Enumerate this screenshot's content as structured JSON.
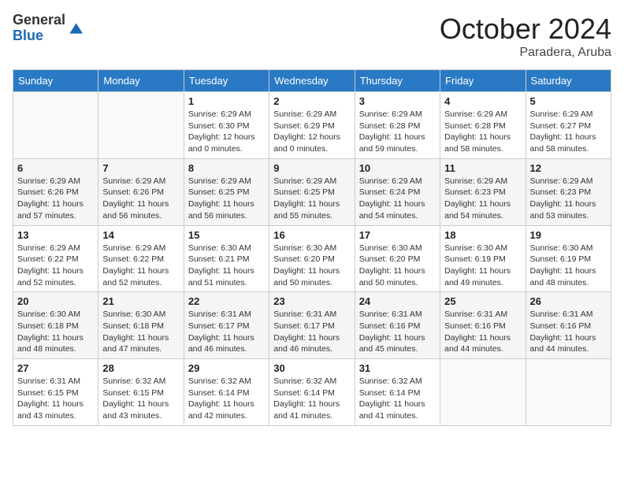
{
  "header": {
    "logo_general": "General",
    "logo_blue": "Blue",
    "month_title": "October 2024",
    "location": "Paradera, Aruba"
  },
  "weekdays": [
    "Sunday",
    "Monday",
    "Tuesday",
    "Wednesday",
    "Thursday",
    "Friday",
    "Saturday"
  ],
  "weeks": [
    [
      {
        "day": "",
        "info": ""
      },
      {
        "day": "",
        "info": ""
      },
      {
        "day": "1",
        "info": "Sunrise: 6:29 AM\nSunset: 6:30 PM\nDaylight: 12 hours and 0 minutes."
      },
      {
        "day": "2",
        "info": "Sunrise: 6:29 AM\nSunset: 6:29 PM\nDaylight: 12 hours and 0 minutes."
      },
      {
        "day": "3",
        "info": "Sunrise: 6:29 AM\nSunset: 6:28 PM\nDaylight: 11 hours and 59 minutes."
      },
      {
        "day": "4",
        "info": "Sunrise: 6:29 AM\nSunset: 6:28 PM\nDaylight: 11 hours and 58 minutes."
      },
      {
        "day": "5",
        "info": "Sunrise: 6:29 AM\nSunset: 6:27 PM\nDaylight: 11 hours and 58 minutes."
      }
    ],
    [
      {
        "day": "6",
        "info": "Sunrise: 6:29 AM\nSunset: 6:26 PM\nDaylight: 11 hours and 57 minutes."
      },
      {
        "day": "7",
        "info": "Sunrise: 6:29 AM\nSunset: 6:26 PM\nDaylight: 11 hours and 56 minutes."
      },
      {
        "day": "8",
        "info": "Sunrise: 6:29 AM\nSunset: 6:25 PM\nDaylight: 11 hours and 56 minutes."
      },
      {
        "day": "9",
        "info": "Sunrise: 6:29 AM\nSunset: 6:25 PM\nDaylight: 11 hours and 55 minutes."
      },
      {
        "day": "10",
        "info": "Sunrise: 6:29 AM\nSunset: 6:24 PM\nDaylight: 11 hours and 54 minutes."
      },
      {
        "day": "11",
        "info": "Sunrise: 6:29 AM\nSunset: 6:23 PM\nDaylight: 11 hours and 54 minutes."
      },
      {
        "day": "12",
        "info": "Sunrise: 6:29 AM\nSunset: 6:23 PM\nDaylight: 11 hours and 53 minutes."
      }
    ],
    [
      {
        "day": "13",
        "info": "Sunrise: 6:29 AM\nSunset: 6:22 PM\nDaylight: 11 hours and 52 minutes."
      },
      {
        "day": "14",
        "info": "Sunrise: 6:29 AM\nSunset: 6:22 PM\nDaylight: 11 hours and 52 minutes."
      },
      {
        "day": "15",
        "info": "Sunrise: 6:30 AM\nSunset: 6:21 PM\nDaylight: 11 hours and 51 minutes."
      },
      {
        "day": "16",
        "info": "Sunrise: 6:30 AM\nSunset: 6:20 PM\nDaylight: 11 hours and 50 minutes."
      },
      {
        "day": "17",
        "info": "Sunrise: 6:30 AM\nSunset: 6:20 PM\nDaylight: 11 hours and 50 minutes."
      },
      {
        "day": "18",
        "info": "Sunrise: 6:30 AM\nSunset: 6:19 PM\nDaylight: 11 hours and 49 minutes."
      },
      {
        "day": "19",
        "info": "Sunrise: 6:30 AM\nSunset: 6:19 PM\nDaylight: 11 hours and 48 minutes."
      }
    ],
    [
      {
        "day": "20",
        "info": "Sunrise: 6:30 AM\nSunset: 6:18 PM\nDaylight: 11 hours and 48 minutes."
      },
      {
        "day": "21",
        "info": "Sunrise: 6:30 AM\nSunset: 6:18 PM\nDaylight: 11 hours and 47 minutes."
      },
      {
        "day": "22",
        "info": "Sunrise: 6:31 AM\nSunset: 6:17 PM\nDaylight: 11 hours and 46 minutes."
      },
      {
        "day": "23",
        "info": "Sunrise: 6:31 AM\nSunset: 6:17 PM\nDaylight: 11 hours and 46 minutes."
      },
      {
        "day": "24",
        "info": "Sunrise: 6:31 AM\nSunset: 6:16 PM\nDaylight: 11 hours and 45 minutes."
      },
      {
        "day": "25",
        "info": "Sunrise: 6:31 AM\nSunset: 6:16 PM\nDaylight: 11 hours and 44 minutes."
      },
      {
        "day": "26",
        "info": "Sunrise: 6:31 AM\nSunset: 6:16 PM\nDaylight: 11 hours and 44 minutes."
      }
    ],
    [
      {
        "day": "27",
        "info": "Sunrise: 6:31 AM\nSunset: 6:15 PM\nDaylight: 11 hours and 43 minutes."
      },
      {
        "day": "28",
        "info": "Sunrise: 6:32 AM\nSunset: 6:15 PM\nDaylight: 11 hours and 43 minutes."
      },
      {
        "day": "29",
        "info": "Sunrise: 6:32 AM\nSunset: 6:14 PM\nDaylight: 11 hours and 42 minutes."
      },
      {
        "day": "30",
        "info": "Sunrise: 6:32 AM\nSunset: 6:14 PM\nDaylight: 11 hours and 41 minutes."
      },
      {
        "day": "31",
        "info": "Sunrise: 6:32 AM\nSunset: 6:14 PM\nDaylight: 11 hours and 41 minutes."
      },
      {
        "day": "",
        "info": ""
      },
      {
        "day": "",
        "info": ""
      }
    ]
  ]
}
